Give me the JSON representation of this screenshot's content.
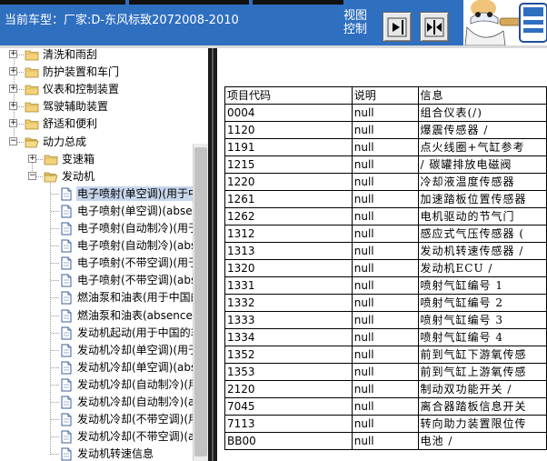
{
  "header": {
    "title": "当前车型：厂家:D-东风标致2072008-2010",
    "view_label_line1": "视图",
    "view_label_line2": "控制"
  },
  "tree": {
    "nodes": [
      {
        "label": "清洗和雨刮",
        "expander": "+",
        "icon": "folder"
      },
      {
        "label": "防护装置和车门",
        "expander": "+",
        "icon": "folder"
      },
      {
        "label": "仪表和控制装置",
        "expander": "+",
        "icon": "folder"
      },
      {
        "label": "驾驶辅助装置",
        "expander": "+",
        "icon": "folder"
      },
      {
        "label": "舒适和便利",
        "expander": "+",
        "icon": "folder"
      },
      {
        "label": "动力总成",
        "expander": "−",
        "icon": "folder-open"
      },
      {
        "label": "变速箱",
        "expander": "+",
        "icon": "folder"
      },
      {
        "label": "发动机",
        "expander": "−",
        "icon": "folder-open"
      },
      {
        "label": "电子喷射(单空调)(用于中",
        "icon": "document",
        "selected": true
      },
      {
        "label": "电子喷射(单空调)(abse",
        "icon": "document"
      },
      {
        "label": "电子喷射(自动制冷)(用于",
        "icon": "document"
      },
      {
        "label": "电子喷射(自动制冷)(abs",
        "icon": "document"
      },
      {
        "label": "电子喷射(不带空调)(用于",
        "icon": "document"
      },
      {
        "label": "电子喷射(不带空调)(abs",
        "icon": "document"
      },
      {
        "label": "燃油泵和油表(用于中国的",
        "icon": "document"
      },
      {
        "label": "燃油泵和油表(absence",
        "icon": "document"
      },
      {
        "label": "发动机起动(用于中国的车",
        "icon": "document"
      },
      {
        "label": "发动机冷却(单空调)(用于",
        "icon": "document"
      },
      {
        "label": "发动机冷却(单空调)(abs",
        "icon": "document"
      },
      {
        "label": "发动机冷却(自动制冷)(用",
        "icon": "document"
      },
      {
        "label": "发动机冷却(自动制冷)(a",
        "icon": "document"
      },
      {
        "label": "发动机冷却(不带空调)(用",
        "icon": "document"
      },
      {
        "label": "发动机冷却(不带空调)(a",
        "icon": "document"
      },
      {
        "label": "发动机转速信息",
        "icon": "document"
      }
    ]
  },
  "table": {
    "headers": [
      "项目代码",
      "说明",
      "信息"
    ],
    "rows": [
      [
        "0004",
        "null",
        "组合仪表(/)"
      ],
      [
        "1120",
        "null",
        "爆震传感器 /"
      ],
      [
        "1191",
        "null",
        "点火线圈+气缸参考"
      ],
      [
        "1215",
        "null",
        "/ 碳罐排放电磁阀"
      ],
      [
        "1220",
        "null",
        "冷却液温度传感器"
      ],
      [
        "1261",
        "null",
        "加速踏板位置传感器"
      ],
      [
        "1262",
        "null",
        "电机驱动的节气门"
      ],
      [
        "1312",
        "null",
        "感应式气压传感器 ("
      ],
      [
        "1313",
        "null",
        "发动机转速传感器 /"
      ],
      [
        "1320",
        "null",
        "发动机ECU /"
      ],
      [
        "1331",
        "null",
        "喷射气缸编号 1"
      ],
      [
        "1332",
        "null",
        "喷射气缸编号 2"
      ],
      [
        "1333",
        "null",
        "喷射气缸编号 3"
      ],
      [
        "1334",
        "null",
        "喷射气缸编号 4"
      ],
      [
        "1352",
        "null",
        "前到气缸下游氧传感"
      ],
      [
        "1353",
        "null",
        "前到气缸上游氧传感"
      ],
      [
        "2120",
        "null",
        "制动双功能开关 /"
      ],
      [
        "7045",
        "null",
        "离合器踏板信息开关"
      ],
      [
        "7113",
        "null",
        "转向助力装置限位传"
      ],
      [
        "BB00",
        "null",
        "电池 /"
      ]
    ]
  },
  "icons": {
    "view_button_1": "arrow-right-bar-icon",
    "view_button_2": "arrows-inward-icon",
    "mascot": "mascot-mechanic-icon"
  },
  "colors": {
    "header_bg": "#2f6fc0",
    "selection_bg": "#c8d6ec",
    "folder_yellow": "#f2d27a",
    "divider": "#1b1b1b"
  }
}
